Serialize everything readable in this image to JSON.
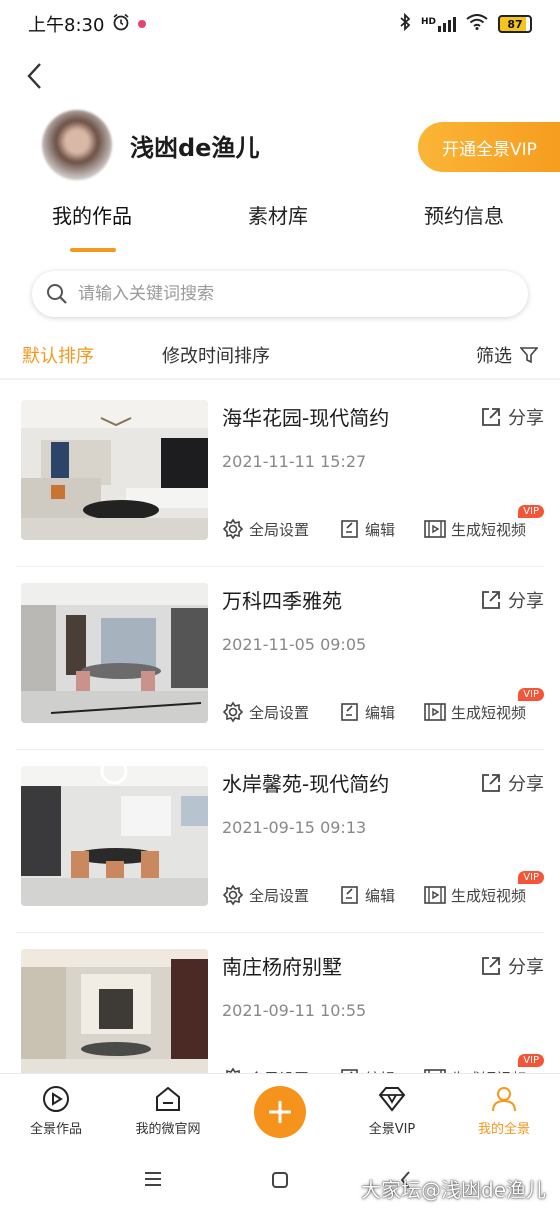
{
  "status_bar": {
    "time": "上午8:30",
    "network": "HD",
    "battery": "87"
  },
  "profile": {
    "username": "浅凼de渔儿",
    "vip_button": "开通全景VIP"
  },
  "tabs": [
    {
      "label": "我的作品",
      "active": true
    },
    {
      "label": "素材库",
      "active": false
    },
    {
      "label": "预约信息",
      "active": false
    }
  ],
  "search": {
    "placeholder": "请输入关键词搜索"
  },
  "sort": {
    "default": "默认排序",
    "modified": "修改时间排序",
    "filter": "筛选"
  },
  "works": [
    {
      "title": "海华花园-现代简约",
      "date": "2021-11-11 15:27"
    },
    {
      "title": "万科四季雅苑",
      "date": "2021-11-05 09:05"
    },
    {
      "title": "水岸馨苑-现代简约",
      "date": "2021-09-15 09:13"
    },
    {
      "title": "南庄杨府别墅",
      "date": "2021-09-11 10:55"
    }
  ],
  "item_actions": {
    "share": "分享",
    "settings": "全局设置",
    "edit": "编辑",
    "video": "生成短视频",
    "vip": "VIP"
  },
  "bottom_nav": [
    {
      "label": "全景作品",
      "icon": "play-circle-icon"
    },
    {
      "label": "我的微官网",
      "icon": "home-icon"
    },
    {
      "label": "",
      "icon": "plus-icon"
    },
    {
      "label": "全景VIP",
      "icon": "diamond-icon"
    },
    {
      "label": "我的全景",
      "icon": "user-icon",
      "active": true
    }
  ],
  "watermark": "大家坛@浅凼de渔儿",
  "colors": {
    "accent": "#f5981e",
    "vip_tag": "#f45536"
  }
}
